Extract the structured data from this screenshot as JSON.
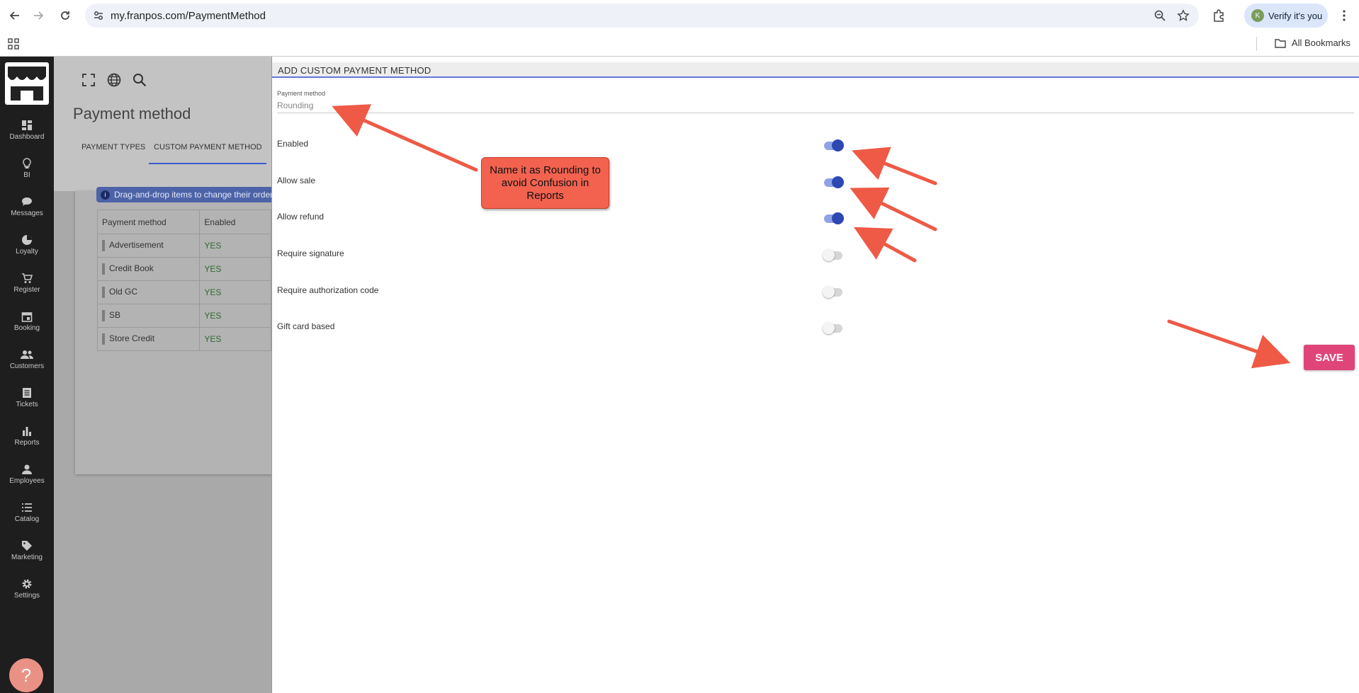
{
  "browser": {
    "url": "my.franpos.com/PaymentMethod",
    "verify_label": "Verify it's you",
    "avatar_letter": "K",
    "bookmarks_label": "All Bookmarks"
  },
  "sidebar": {
    "items": [
      {
        "label": "Dashboard",
        "icon": "dashboard-icon"
      },
      {
        "label": "BI",
        "icon": "lightbulb-icon"
      },
      {
        "label": "Messages",
        "icon": "chat-icon"
      },
      {
        "label": "Loyalty",
        "icon": "pie-icon"
      },
      {
        "label": "Register",
        "icon": "cart-icon"
      },
      {
        "label": "Booking",
        "icon": "calendar-icon"
      },
      {
        "label": "Customers",
        "icon": "people-icon"
      },
      {
        "label": "Tickets",
        "icon": "ticket-icon"
      },
      {
        "label": "Reports",
        "icon": "bar-chart-icon"
      },
      {
        "label": "Employees",
        "icon": "person-icon"
      },
      {
        "label": "Catalog",
        "icon": "list-icon"
      },
      {
        "label": "Marketing",
        "icon": "tag-icon"
      },
      {
        "label": "Settings",
        "icon": "gear-icon"
      }
    ],
    "help": "?"
  },
  "page": {
    "title": "Payment method",
    "tabs": [
      "PAYMENT TYPES",
      "CUSTOM PAYMENT METHOD"
    ],
    "info": "Drag-and-drop items to change their order",
    "table": {
      "headers": [
        "Payment method",
        "Enabled"
      ],
      "rows": [
        [
          "Advertisement",
          "YES"
        ],
        [
          "Credit Book",
          "YES"
        ],
        [
          "Old GC",
          "YES"
        ],
        [
          "SB",
          "YES"
        ],
        [
          "Store Credit",
          "YES"
        ]
      ]
    }
  },
  "panel": {
    "title": "ADD CUSTOM PAYMENT METHOD",
    "field_label": "Payment method",
    "field_value": "Rounding",
    "options": [
      {
        "label": "Enabled",
        "on": true
      },
      {
        "label": "Allow sale",
        "on": true
      },
      {
        "label": "Allow refund",
        "on": true
      },
      {
        "label": "Require signature",
        "on": false
      },
      {
        "label": "Require authorization code",
        "on": false
      },
      {
        "label": "Gift card based",
        "on": false
      }
    ],
    "save_label": "SAVE",
    "accent": "#2d47b3",
    "save_color": "#e0457a"
  },
  "annotation": {
    "callout_text": "Name it as Rounding to avoid Confusion in Reports",
    "color": "#f2624f"
  }
}
